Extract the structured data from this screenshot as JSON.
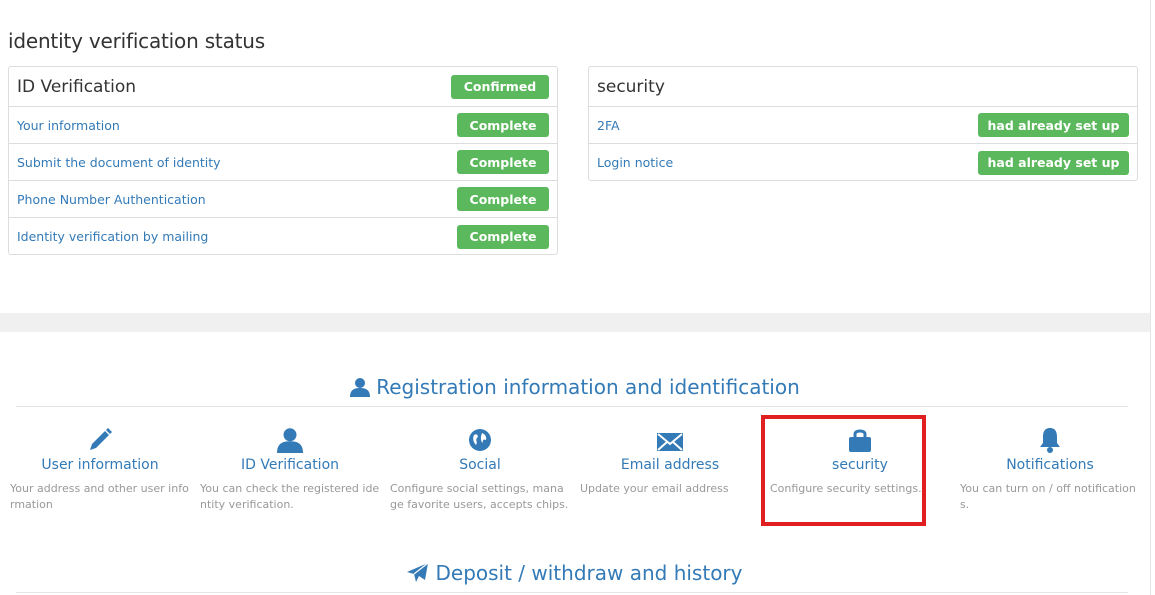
{
  "status": {
    "title": "identity verification status"
  },
  "id_panel": {
    "title": "ID Verification",
    "header_badge": "Confirmed",
    "rows": [
      {
        "label": "Your information",
        "badge": "Complete"
      },
      {
        "label": "Submit the document of identity",
        "badge": "Complete"
      },
      {
        "label": "Phone Number Authentication",
        "badge": "Complete"
      },
      {
        "label": "Identity verification by mailing",
        "badge": "Complete"
      }
    ]
  },
  "security_panel": {
    "title": "security",
    "rows": [
      {
        "label": "2FA",
        "badge": "had already set up"
      },
      {
        "label": "Login notice",
        "badge": "had already set up"
      }
    ]
  },
  "registration": {
    "title": "Registration information and identification",
    "icon": "user-icon",
    "tiles": [
      {
        "icon": "pencil-icon",
        "label": "User information",
        "desc": "Your address and other user information"
      },
      {
        "icon": "user-icon",
        "label": "ID Verification",
        "desc": "You can check the registered identity verification."
      },
      {
        "icon": "globe-icon",
        "label": "Social",
        "desc": "Configure social settings, manage favorite users, accepts chips."
      },
      {
        "icon": "envelope-icon",
        "label": "Email address",
        "desc": "Update your email address"
      },
      {
        "icon": "lock-icon",
        "label": "security",
        "desc": "Configure security settings."
      },
      {
        "icon": "bell-icon",
        "label": "Notifications",
        "desc": "You can turn on / off notifications."
      }
    ]
  },
  "deposit": {
    "title": "Deposit / withdraw and history",
    "icon": "paper-plane-icon"
  },
  "colors": {
    "link": "#337ab7",
    "success": "#5cb85c",
    "highlight": "#e02020",
    "muted": "#999999"
  }
}
